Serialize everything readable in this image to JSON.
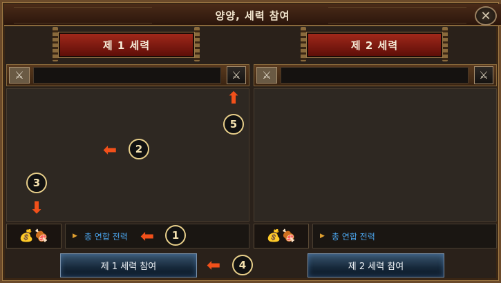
{
  "window": {
    "title": "양양, 세력 참여",
    "close_icon": "close-icon"
  },
  "factions": [
    {
      "name": "제 1 세력",
      "search_value": "",
      "total_power_label": "총 연합 전력",
      "join_label": "제 1 세력 참여"
    },
    {
      "name": "제 2 세력",
      "search_value": "",
      "total_power_label": "총 연합 전력",
      "join_label": "제 2 세력 참여"
    }
  ],
  "annotations": {
    "n1": "1",
    "n2": "2",
    "n3": "3",
    "n4": "4",
    "n5": "5"
  },
  "colors": {
    "accent_red": "#a0281a",
    "link_blue": "#4aa2e8",
    "annotation_orange": "#f2501a"
  }
}
